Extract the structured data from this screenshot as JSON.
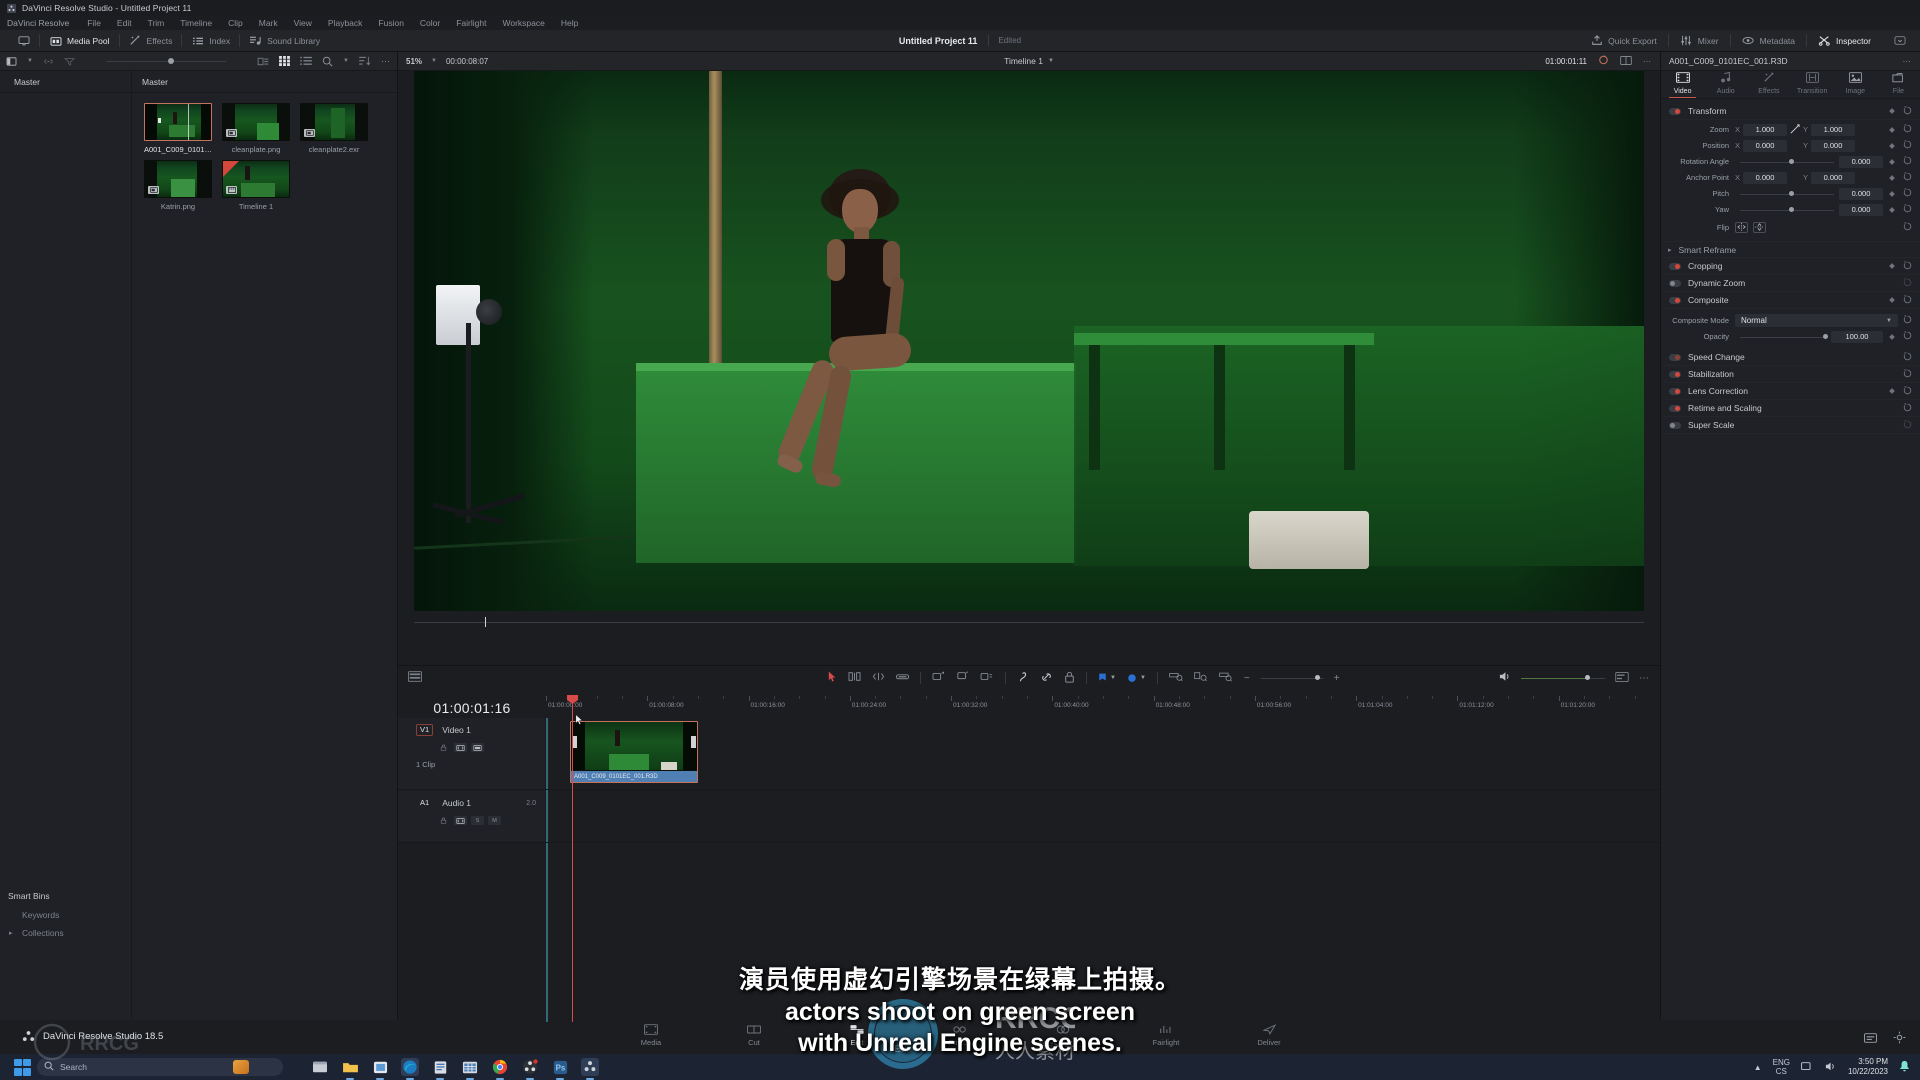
{
  "window": {
    "title": "DaVinci Resolve Studio - Untitled Project 11",
    "app_icon": "resolve-icon"
  },
  "menubar": {
    "items": [
      "DaVinci Resolve",
      "File",
      "Edit",
      "Trim",
      "Timeline",
      "Clip",
      "Mark",
      "View",
      "Playback",
      "Fusion",
      "Color",
      "Fairlight",
      "Workspace",
      "Help"
    ]
  },
  "toptoolbar": {
    "left_items": [
      {
        "label": "Media Pool",
        "icon": "media-pool-icon",
        "active": true
      },
      {
        "label": "Effects",
        "icon": "effects-icon",
        "active": false
      },
      {
        "label": "Index",
        "icon": "index-icon",
        "active": false
      },
      {
        "label": "Sound Library",
        "icon": "sound-library-icon",
        "active": false
      }
    ],
    "project_title": "Untitled Project 11",
    "project_status": "Edited",
    "right_items": [
      {
        "label": "Quick Export",
        "icon": "export-icon",
        "active": false
      },
      {
        "label": "Mixer",
        "icon": "mixer-icon",
        "active": false
      },
      {
        "label": "Metadata",
        "icon": "metadata-icon",
        "active": false
      },
      {
        "label": "Inspector",
        "icon": "inspector-icon",
        "active": true
      }
    ]
  },
  "mediapool": {
    "toolbar": {
      "zoom_label": "51%",
      "timecode": "00:00:08:07"
    },
    "tree_header": "Master",
    "grid_header": "Master",
    "smart_bins_title": "Smart Bins",
    "tree_items": [
      "Keywords",
      "Collections"
    ],
    "clips": [
      {
        "name": "A001_C009_0101E...",
        "type": "video",
        "selected": true
      },
      {
        "name": "cleanplate.png",
        "type": "image",
        "selected": false
      },
      {
        "name": "cleanplate2.exr",
        "type": "image",
        "selected": false
      },
      {
        "name": "Katrin.png",
        "type": "image",
        "selected": false
      },
      {
        "name": "Timeline 1",
        "type": "timeline",
        "selected": false
      }
    ]
  },
  "viewer": {
    "timeline_name": "Timeline 1",
    "timecode": "01:00:01:11"
  },
  "inspector": {
    "clip_name": "A001_C009_0101EC_001.R3D",
    "tabs": [
      {
        "label": "Video",
        "icon": "video-tab-icon",
        "active": true
      },
      {
        "label": "Audio",
        "icon": "audio-tab-icon",
        "active": false
      },
      {
        "label": "Effects",
        "icon": "effects-tab-icon",
        "active": false
      },
      {
        "label": "Transition",
        "icon": "transition-tab-icon",
        "active": false
      },
      {
        "label": "Image",
        "icon": "image-tab-icon",
        "active": false
      },
      {
        "label": "File",
        "icon": "file-tab-icon",
        "active": false
      }
    ],
    "transform": {
      "title": "Transform",
      "zoom": {
        "label": "Zoom",
        "x": "1.000",
        "y": "1.000"
      },
      "position": {
        "label": "Position",
        "x": "0.000",
        "y": "0.000"
      },
      "rotation": {
        "label": "Rotation Angle",
        "value": "0.000"
      },
      "anchor": {
        "label": "Anchor Point",
        "x": "0.000",
        "y": "0.000"
      },
      "pitch": {
        "label": "Pitch",
        "value": "0.000"
      },
      "yaw": {
        "label": "Yaw",
        "value": "0.000"
      },
      "flip": {
        "label": "Flip"
      }
    },
    "smart_reframe": "Smart Reframe",
    "cropping": "Cropping",
    "dynamic_zoom": "Dynamic Zoom",
    "composite": {
      "title": "Composite",
      "mode_label": "Composite Mode",
      "mode_value": "Normal",
      "opacity_label": "Opacity",
      "opacity_value": "100.00"
    },
    "speed_change": "Speed Change",
    "stabilization": "Stabilization",
    "lens_correction": "Lens Correction",
    "retime_scaling": "Retime and Scaling",
    "super_scale": "Super Scale"
  },
  "timeline": {
    "current_timecode": "01:00:01:16",
    "ruler_labels": [
      "01:00:00:00",
      "01:00:08:00",
      "01:00:16:00",
      "01:00:24:00",
      "01:00:32:00",
      "01:00:40:00",
      "01:00:48:00",
      "01:00:56:00",
      "01:01:04:00",
      "01:01:12:00",
      "01:01:20:00"
    ],
    "tracks": [
      {
        "id": "V1",
        "name": "Video 1",
        "clip_count": "1 Clip",
        "channels": ""
      },
      {
        "id": "A1",
        "name": "Audio 1",
        "clip_count": "",
        "channels": "2.0"
      }
    ],
    "clip_name": "A001_C009_0101EC_001.R3D"
  },
  "subtitles": {
    "line1": "演员使用虚幻引擎场景在绿幕上拍摄。",
    "line2": "actors shoot on green screen",
    "line3": "with Unreal Engine scenes."
  },
  "statusbar": {
    "app_name": "DaVinci Resolve Studio 18.5",
    "pages": [
      {
        "label": "Media",
        "icon": "media-page-icon",
        "active": false
      },
      {
        "label": "Cut",
        "icon": "cut-page-icon",
        "active": false
      },
      {
        "label": "Edit",
        "icon": "edit-page-icon",
        "active": true
      },
      {
        "label": "Fusion",
        "icon": "fusion-page-icon",
        "active": false
      },
      {
        "label": "Color",
        "icon": "color-page-icon",
        "active": false
      },
      {
        "label": "Fairlight",
        "icon": "fairlight-page-icon",
        "active": false
      },
      {
        "label": "Deliver",
        "icon": "deliver-page-icon",
        "active": false
      }
    ]
  },
  "taskbar": {
    "search_placeholder": "Search",
    "apps": [
      "file-explorer-icon",
      "folder-icon",
      "store-icon",
      "edge-icon",
      "notes-icon",
      "excel-icon",
      "chrome-icon",
      "resolve-icon",
      "photoshop-icon",
      "resolve-studio-icon"
    ],
    "lang": "ENG",
    "lang_sub": "CS",
    "time": "3:50 PM",
    "date": "10/22/2023"
  },
  "colors": {
    "accent_red": "#d4473c",
    "clip_blue": "#4f7fb3",
    "selection": "#c4745e",
    "green_screen": "#16571f",
    "taskbar": "#1c2433"
  }
}
